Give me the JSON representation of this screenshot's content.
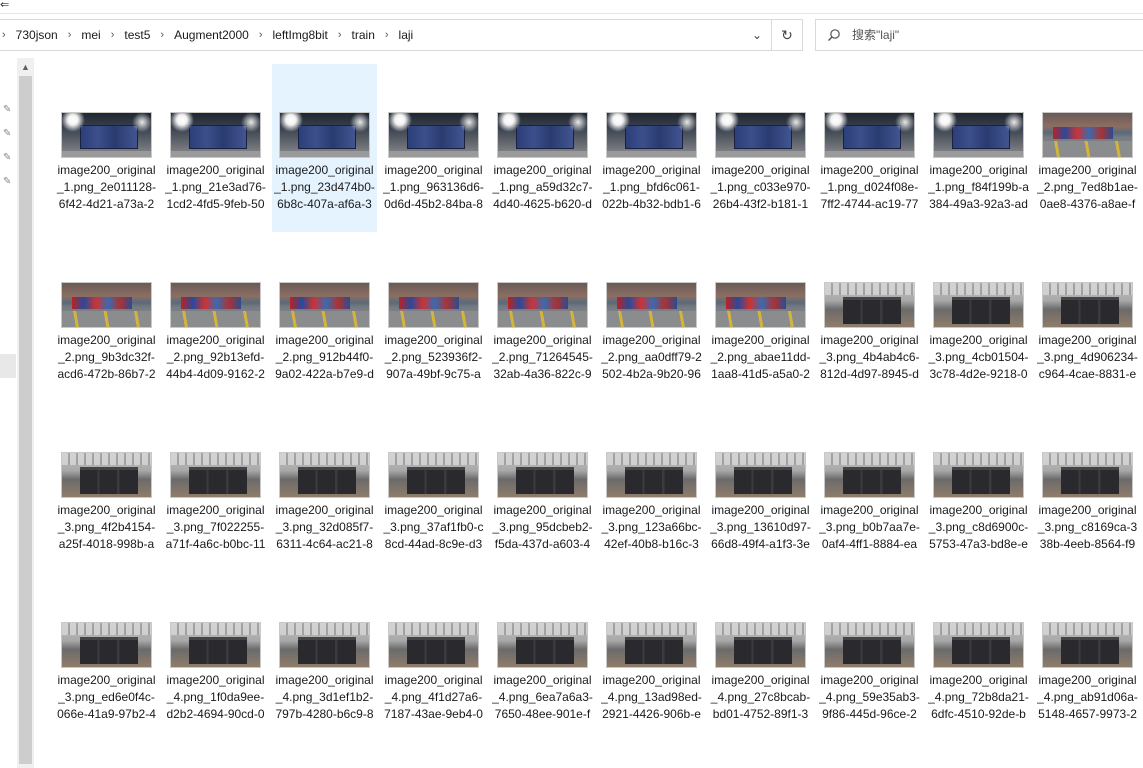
{
  "toolbar_glyph": "⇐",
  "address": {
    "crumbs": [
      "730json",
      "mei",
      "test5",
      "Augment2000",
      "leftImg8bit",
      "train",
      "laji"
    ],
    "separator": "›",
    "dropdown_glyph": "⌄",
    "refresh_glyph": "↻"
  },
  "search": {
    "placeholder": "搜索\"laji\"",
    "icon_glyph": "⌕"
  },
  "pins": [
    "✎",
    "✎",
    "✎",
    "✎"
  ],
  "scroll_up_glyph": "▲",
  "files": [
    {
      "name": "image200_original_1.png_2e011128-6f42-4d21-a73a-2e4baa...",
      "thumb": "night"
    },
    {
      "name": "image200_original_1.png_21e3ad76-1cd2-4fd5-9feb-50397...",
      "thumb": "night"
    },
    {
      "name": "image200_original_1.png_23d474b0-6b8c-407a-af6a-39ffab...",
      "thumb": "night"
    },
    {
      "name": "image200_original_1.png_963136d6-0d6d-45b2-84ba-88fed...",
      "thumb": "night"
    },
    {
      "name": "image200_original_1.png_a59d32c7-4d40-4625-b620-d52e...",
      "thumb": "night"
    },
    {
      "name": "image200_original_1.png_bfd6c061-022b-4b32-bdb1-6f113...",
      "thumb": "night"
    },
    {
      "name": "image200_original_1.png_c033e970-26b4-43f2-b181-14eed0...",
      "thumb": "night"
    },
    {
      "name": "image200_original_1.png_d024f08e-7ff2-4744-ac19-77740c6...",
      "thumb": "night"
    },
    {
      "name": "image200_original_1.png_f84f199b-a384-49a3-92a3-adeb2...",
      "thumb": "night"
    },
    {
      "name": "image200_original_2.png_7ed8b1ae-0ae8-4376-a8ae-f1017...",
      "thumb": "street"
    },
    {
      "name": "image200_original_2.png_9b3dc32f-acd6-472b-86b7-2b3da...",
      "thumb": "street"
    },
    {
      "name": "image200_original_2.png_92b13efd-44b4-4d09-9162-2f64c...",
      "thumb": "street"
    },
    {
      "name": "image200_original_2.png_912b44f0-9a02-422a-b7e9-db640...",
      "thumb": "street"
    },
    {
      "name": "image200_original_2.png_523936f2-907a-49bf-9c75-a9d02f...",
      "thumb": "street"
    },
    {
      "name": "image200_original_2.png_71264545-32ab-4a36-822c-99a52...",
      "thumb": "street"
    },
    {
      "name": "image200_original_2.png_aa0dff79-2502-4b2a-9b20-96311...",
      "thumb": "street"
    },
    {
      "name": "image200_original_2.png_abae11dd-1aa8-41d5-a5a0-2aa0f...",
      "thumb": "street"
    },
    {
      "name": "image200_original_3.png_4b4ab4c6-812d-4d97-8945-d9ad...",
      "thumb": "bins"
    },
    {
      "name": "image200_original_3.png_4cb01504-3c78-4d2e-9218-0a627...",
      "thumb": "bins"
    },
    {
      "name": "image200_original_3.png_4d906234-c964-4cae-8831-e06ea0...",
      "thumb": "bins"
    },
    {
      "name": "image200_original_3.png_4f2b4154-a25f-4018-998b-aa91dc...",
      "thumb": "bins"
    },
    {
      "name": "image200_original_3.png_7f022255-a71f-4a6c-b0bc-11f28ce...",
      "thumb": "bins"
    },
    {
      "name": "image200_original_3.png_32d085f7-6311-4c64-ac21-8acec1...",
      "thumb": "bins"
    },
    {
      "name": "image200_original_3.png_37af1fb0-c8cd-44ad-8c9e-d3285d7...",
      "thumb": "bins"
    },
    {
      "name": "image200_original_3.png_95dcbeb2-f5da-437d-a603-4834...",
      "thumb": "bins"
    },
    {
      "name": "image200_original_3.png_123a66bc-42ef-40b8-b16c-342344...",
      "thumb": "bins"
    },
    {
      "name": "image200_original_3.png_13610d97-66d8-49f4-a1f3-3efff9...",
      "thumb": "bins"
    },
    {
      "name": "image200_original_3.png_b0b7aa7e-0af4-4ff1-8884-ea283b...",
      "thumb": "bins"
    },
    {
      "name": "image200_original_3.png_c8d6900c-5753-47a3-bd8e-e71e...",
      "thumb": "bins"
    },
    {
      "name": "image200_original_3.png_c8169ca-338b-4eeb-8564-f958e...",
      "thumb": "bins"
    },
    {
      "name": "image200_original_3.png_ed6e0f4c-066e-41a9-97b2-475a0e...",
      "thumb": "bins"
    },
    {
      "name": "image200_original_4.png_1f0da9ee-d2b2-4694-90cd-07ed...",
      "thumb": "bins"
    },
    {
      "name": "image200_original_4.png_3d1ef1b2-797b-4280-b6c9-8d6af...",
      "thumb": "bins"
    },
    {
      "name": "image200_original_4.png_4f1d27a6-7187-43ae-9eb4-0a09...",
      "thumb": "bins"
    },
    {
      "name": "image200_original_4.png_6ea7a6a3-7650-48ee-901e-fa4c5...",
      "thumb": "bins"
    },
    {
      "name": "image200_original_4.png_13ad98ed-2921-4426-906b-ec25a...",
      "thumb": "bins"
    },
    {
      "name": "image200_original_4.png_27c8bcab-bd01-4752-89f1-382c7f...",
      "thumb": "bins"
    },
    {
      "name": "image200_original_4.png_59e35ab3-9f86-445d-96ce-248fd...",
      "thumb": "bins"
    },
    {
      "name": "image200_original_4.png_72b8da21-6dfc-4510-92de-b59c09...",
      "thumb": "bins"
    },
    {
      "name": "image200_original_4.png_ab91d06a-5148-4657-9973-2ac43...",
      "thumb": "bins"
    }
  ],
  "selected_index": 2
}
